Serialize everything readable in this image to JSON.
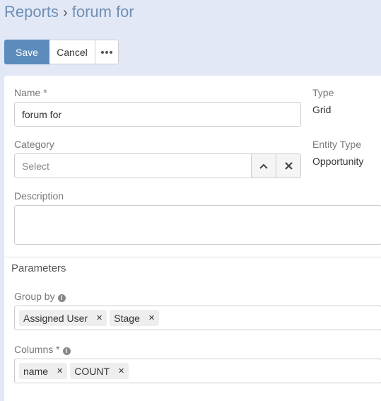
{
  "breadcrumb": {
    "root": "Reports",
    "separator": "›",
    "current": "forum for"
  },
  "toolbar": {
    "save_label": "Save",
    "cancel_label": "Cancel"
  },
  "form": {
    "name": {
      "label": "Name *",
      "value": "forum for"
    },
    "type": {
      "label": "Type",
      "value": "Grid"
    },
    "category": {
      "label": "Category",
      "placeholder": "Select"
    },
    "entity_type": {
      "label": "Entity Type",
      "value": "Opportunity"
    },
    "description": {
      "label": "Description",
      "value": ""
    }
  },
  "parameters": {
    "title": "Parameters",
    "group_by": {
      "label": "Group by",
      "tags": [
        "Assigned User",
        "Stage"
      ]
    },
    "columns": {
      "label": "Columns *",
      "tags": [
        "name",
        "COUNT"
      ]
    }
  },
  "icons": {
    "info": "info-icon",
    "more": "ellipsis-icon",
    "up": "chevron-up-icon",
    "clear": "close-icon"
  },
  "colors": {
    "primary": "#5b8cbb",
    "background": "#e3e8f7",
    "breadcrumb": "#6d8fb3"
  }
}
